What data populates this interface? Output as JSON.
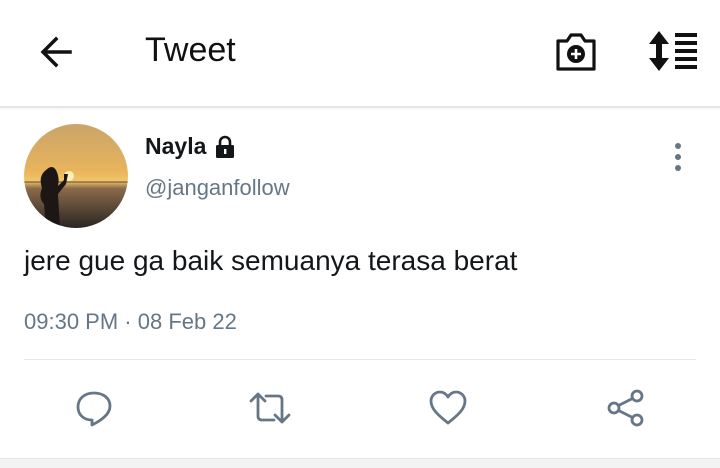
{
  "header": {
    "title": "Tweet",
    "icons": {
      "back": "arrow-left-icon",
      "camera": "camera-plus-icon",
      "sort": "sort-list-icon"
    }
  },
  "tweet": {
    "author_name": "Nayla",
    "author_handle": "@janganfollow",
    "protected_icon": "lock-icon",
    "text": "jere gue ga baik semuanya terasa berat",
    "time": "09:30 PM",
    "separator": "·",
    "date": "08 Feb 22"
  },
  "actions": {
    "icons": [
      "reply-icon",
      "retweet-icon",
      "like-icon",
      "share-icon"
    ]
  },
  "colors": {
    "secondary_text": "#657786",
    "primary_text": "#14171a",
    "divider": "#e1e8ed"
  }
}
